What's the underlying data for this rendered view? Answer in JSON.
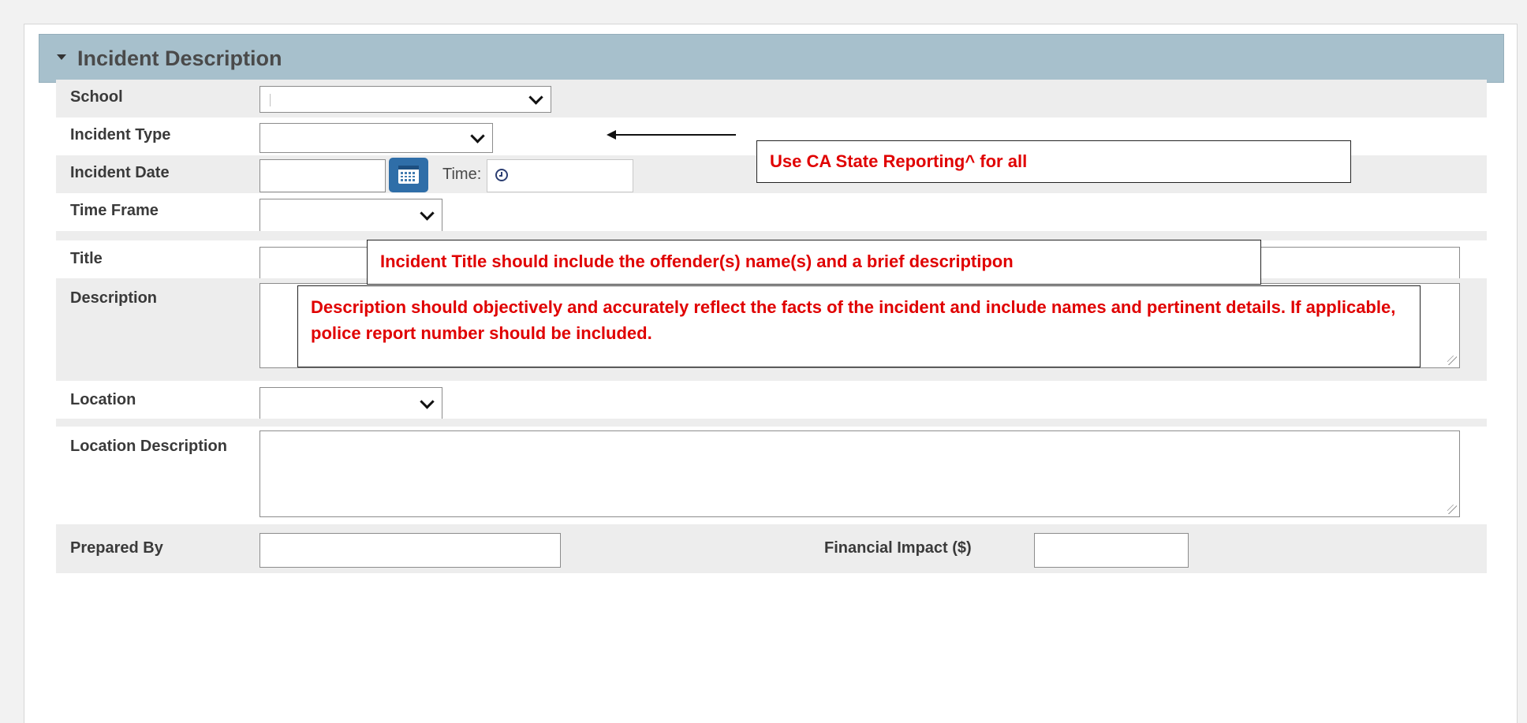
{
  "section": {
    "title": "Incident Description"
  },
  "fields": {
    "school": {
      "label": "School",
      "value": ""
    },
    "incident_type": {
      "label": "Incident Type",
      "value": ""
    },
    "incident_date": {
      "label": "Incident Date",
      "value": "",
      "time_label": "Time:",
      "time_value": ""
    },
    "time_frame": {
      "label": "Time Frame",
      "value": ""
    },
    "title": {
      "label": "Title",
      "value": ""
    },
    "description": {
      "label": "Description",
      "value": ""
    },
    "location": {
      "label": "Location",
      "value": ""
    },
    "location_description": {
      "label": "Location Description",
      "value": ""
    },
    "prepared_by": {
      "label": "Prepared By",
      "value": ""
    },
    "financial_impact": {
      "label": "Financial Impact ($)",
      "value": ""
    }
  },
  "annotations": {
    "incident_type_note": "Use CA State Reporting^ for all",
    "title_note": "Incident Title should include the offender(s) name(s) and a brief descriptipon",
    "description_note": "Description should objectively and accurately reflect the facts of the incident and include names and pertinent details. If applicable, police report number should be included."
  },
  "icons": {
    "collapse": "caret-down-icon",
    "calendar": "calendar-icon",
    "clock": "clock-icon",
    "select": "chevron-down-icon"
  },
  "colors": {
    "header_bg": "#a7c0cc",
    "annotation_text": "#e00000",
    "calendar_button": "#2f6ea8",
    "row_shade": "#ededed"
  }
}
